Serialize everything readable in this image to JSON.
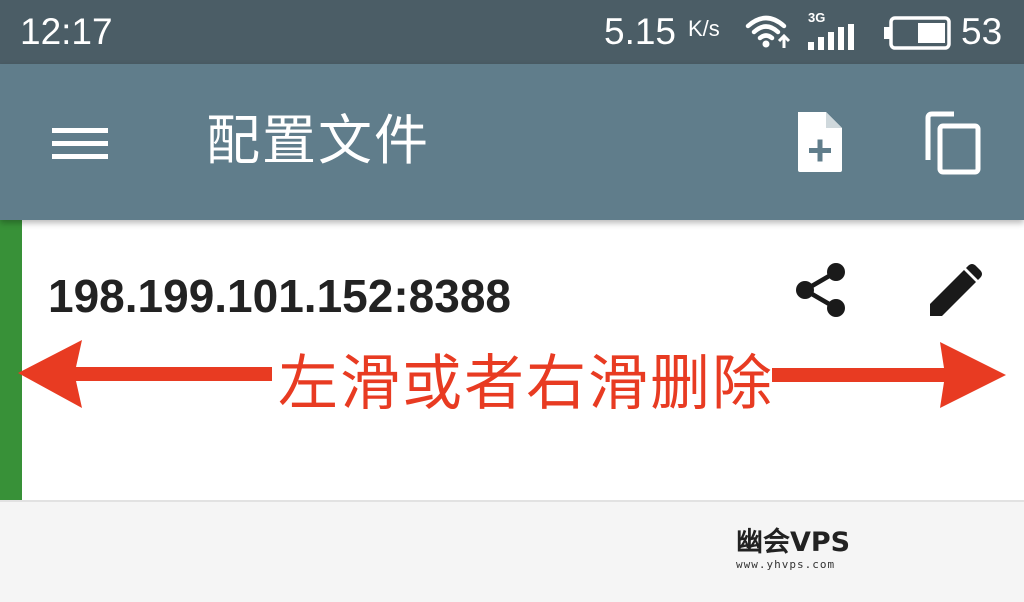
{
  "status_bar": {
    "time": "12:17",
    "speed_value": "5.15",
    "speed_unit": "K/s",
    "network_type": "3G",
    "battery_level": "53",
    "icons": [
      "wifi-upload-icon",
      "cellular-signal-icon",
      "battery-icon"
    ]
  },
  "app_bar": {
    "title": "配置文件",
    "menu_icon": "hamburger-menu-icon",
    "actions": [
      "add-file-icon",
      "copy-icon"
    ]
  },
  "profiles": [
    {
      "address": "198.199.101.152:8388",
      "active": true,
      "actions": [
        "share-icon",
        "edit-icon"
      ]
    }
  ],
  "annotation": {
    "text": "左滑或者右滑删除",
    "color": "#e83b22"
  },
  "watermark": {
    "logo_text": "幽会VPS",
    "url": "www.yhvps.com"
  },
  "colors": {
    "status_bar": "#4b5d66",
    "app_bar": "#607d8b",
    "active_accent": "#389138",
    "background": "#f5f5f5"
  }
}
